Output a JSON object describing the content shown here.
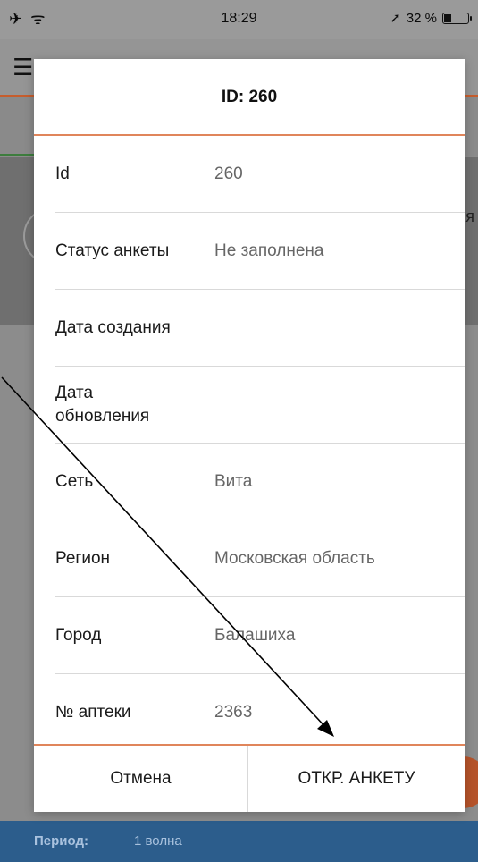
{
  "status_bar": {
    "left_icons": "✈ ᯤ",
    "time": "18:29",
    "battery_text": "32 %"
  },
  "dialog": {
    "title": "ID: 260",
    "rows": [
      {
        "label": "Id",
        "value": "260"
      },
      {
        "label": "Статус анкеты",
        "value": "Не заполнена"
      },
      {
        "label": "Дата создания",
        "value": ""
      },
      {
        "label": "Дата обновления",
        "value": ""
      },
      {
        "label": "Сеть",
        "value": "Вита"
      },
      {
        "label": "Регион",
        "value": "Московская область"
      },
      {
        "label": "Город",
        "value": "Балашиха"
      },
      {
        "label": "№ аптеки",
        "value": "2363"
      }
    ],
    "cancel_label": "Отмена",
    "open_label": "ОТКР. АНКЕТУ"
  },
  "background": {
    "partial_letter": "я",
    "period_label": "Период:",
    "period_value": "1 волна"
  },
  "colors": {
    "accent": "#e0855b",
    "bottom_bar": "#2c5d8c"
  }
}
